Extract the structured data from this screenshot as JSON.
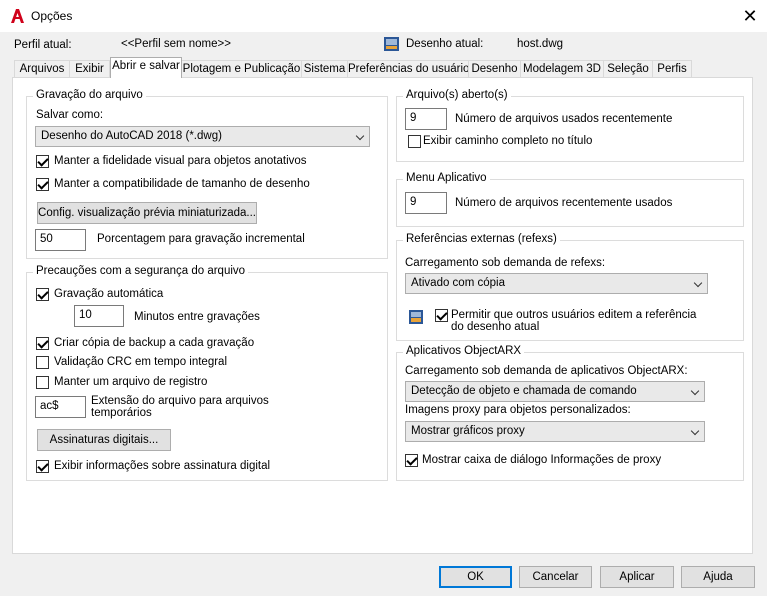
{
  "window": {
    "title": "Opções"
  },
  "header": {
    "profile_label": "Perfil atual:",
    "profile_value": "<<Perfil sem nome>>",
    "drawing_label": "Desenho atual:",
    "drawing_value": "host.dwg"
  },
  "tabs": [
    {
      "label": "Arquivos"
    },
    {
      "label": "Exibir"
    },
    {
      "label": "Abrir e salvar",
      "active": true
    },
    {
      "label": "Plotagem e Publicação"
    },
    {
      "label": "Sistema"
    },
    {
      "label": "Preferências do usuário"
    },
    {
      "label": "Desenho"
    },
    {
      "label": "Modelagem 3D"
    },
    {
      "label": "Seleção"
    },
    {
      "label": "Perfis"
    }
  ],
  "file_save": {
    "title": "Gravação do arquivo",
    "save_as_label": "Salvar como:",
    "save_as_value": "Desenho do AutoCAD 2018 (*.dwg)",
    "keep_fidelity": {
      "label": "Manter a fidelidade visual para objetos anotativos",
      "checked": true
    },
    "keep_size_compat": {
      "label": "Manter a compatibilidade de tamanho de desenho",
      "checked": true
    },
    "thumbnail_button": "Config. visualização prévia miniaturizada...",
    "incremental_value": "50",
    "incremental_label": "Porcentagem para gravação incremental"
  },
  "safety": {
    "title": "Precauções com a segurança do arquivo",
    "autosave": {
      "label": "Gravação automática",
      "checked": true
    },
    "minutes_value": "10",
    "minutes_label": "Minutos entre gravações",
    "backup": {
      "label": "Criar cópia de backup a cada gravação",
      "checked": true
    },
    "crc": {
      "label": "Validação CRC em tempo integral",
      "checked": false
    },
    "log": {
      "label": "Manter um arquivo de registro",
      "checked": false
    },
    "temp_ext_value": "ac$",
    "temp_ext_label_line1": "Extensão do arquivo para arquivos",
    "temp_ext_label_line2": "temporários",
    "digital_sig_button": "Assinaturas digitais...",
    "show_sig": {
      "label": "Exibir informações sobre assinatura digital",
      "checked": true
    }
  },
  "open_files": {
    "title": "Arquivo(s) aberto(s)",
    "recent_value": "9",
    "recent_label": "Número de arquivos usados recentemente",
    "full_path": {
      "label": "Exibir caminho completo no título",
      "checked": false
    }
  },
  "app_menu": {
    "title": "Menu Aplicativo",
    "recent_value": "9",
    "recent_label": "Número de arquivos recentemente usados"
  },
  "xrefs": {
    "title": "Referências externas (refexs)",
    "demand_label": "Carregamento sob demanda de refexs:",
    "demand_value": "Ativado com cópia",
    "allow_edit": {
      "label_line1": "Permitir que outros usuários editem a referência",
      "label_line2": "do desenho atual",
      "checked": true
    }
  },
  "objectarx": {
    "title": "Aplicativos ObjectARX",
    "demand_label": "Carregamento sob demanda de aplicativos ObjectARX:",
    "demand_value": "Detecção de objeto e chamada de comando",
    "proxy_label": "Imagens proxy para objetos personalizados:",
    "proxy_value": "Mostrar gráficos proxy",
    "proxy_dialog": {
      "label": "Mostrar caixa de diálogo Informações de proxy",
      "checked": true
    }
  },
  "footer": {
    "ok": "OK",
    "cancel": "Cancelar",
    "apply": "Aplicar",
    "help": "Ajuda"
  }
}
